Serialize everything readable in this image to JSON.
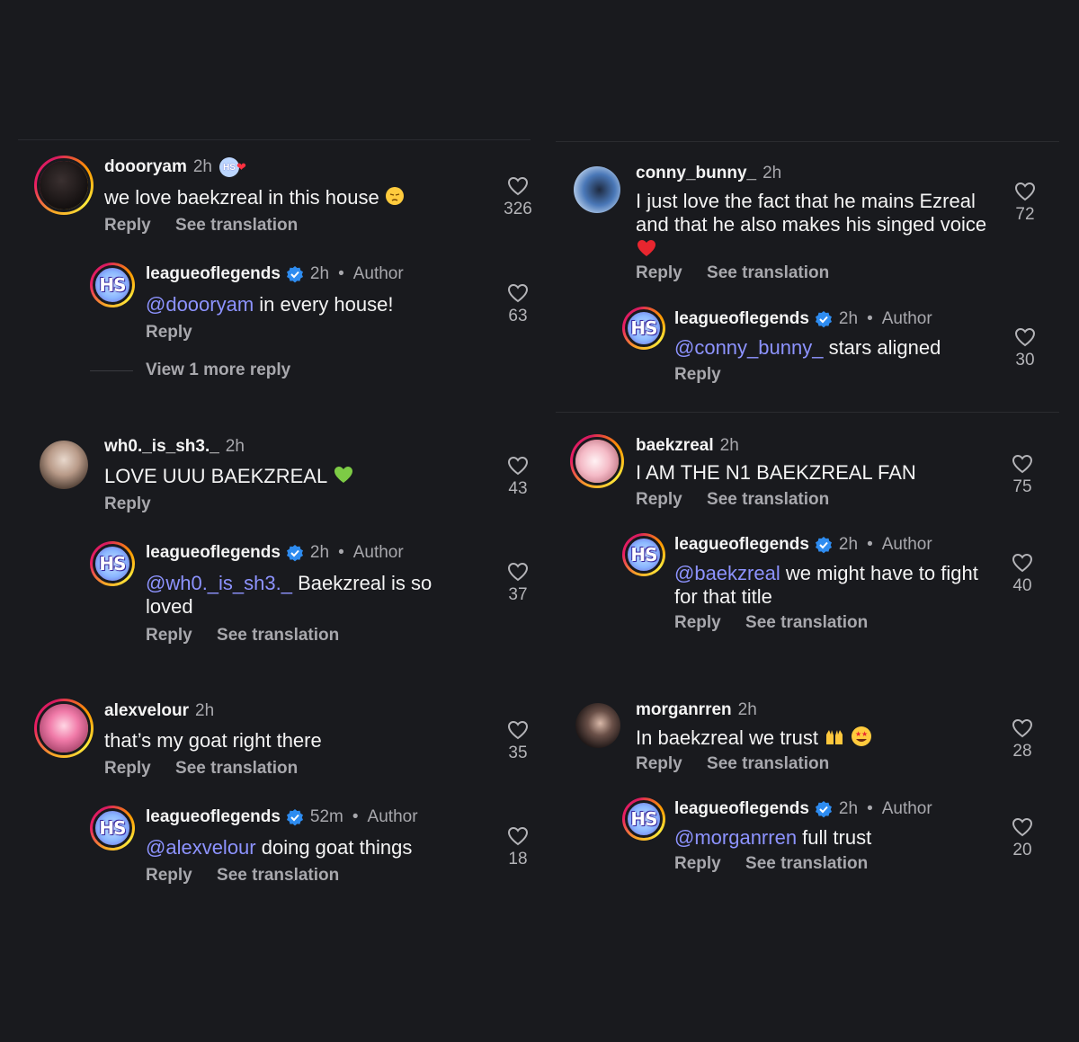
{
  "ui": {
    "reply": "Reply",
    "see_translation": "See translation",
    "author": "Author",
    "dot": "•"
  },
  "left": [
    {
      "user": "doooryam",
      "time": "2h",
      "text": "we love baekzreal in this house",
      "likes": "326",
      "reply": {
        "user": "leagueoflegends",
        "time": "2h",
        "mention": "@doooryam",
        "text": " in every house!",
        "likes": "63",
        "view_more": "View 1 more reply"
      }
    },
    {
      "user": "wh0._is_sh3._",
      "time": "2h",
      "text": "LOVE UUU BAEKZREAL",
      "likes": "43",
      "reply": {
        "user": "leagueoflegends",
        "time": "2h",
        "mention": "@wh0._is_sh3._",
        "text": " Baekzreal is so loved",
        "likes": "37"
      }
    },
    {
      "user": "alexvelour",
      "time": "2h",
      "text": "that’s my goat right there",
      "likes": "35",
      "reply": {
        "user": "leagueoflegends",
        "time": "52m",
        "mention": "@alexvelour",
        "text": " doing goat things",
        "likes": "18"
      }
    }
  ],
  "right": [
    {
      "user": "conny_bunny_",
      "time": "2h",
      "text": "I just love the fact that he mains Ezreal and that he also makes his singed voice",
      "likes": "72",
      "reply": {
        "user": "leagueoflegends",
        "time": "2h",
        "mention": "@conny_bunny_",
        "text": " stars aligned",
        "likes": "30"
      }
    },
    {
      "user": "baekzreal",
      "time": "2h",
      "text": "I AM THE N1 BAEKZREAL FAN",
      "likes": "75",
      "reply": {
        "user": "leagueoflegends",
        "time": "2h",
        "mention": "@baekzreal",
        "text": " we might have to fight for that title",
        "likes": "40"
      }
    },
    {
      "user": "morganrren",
      "time": "2h",
      "text": "In baekzreal we trust",
      "likes": "28",
      "reply": {
        "user": "leagueoflegends",
        "time": "2h",
        "mention": "@morganrren",
        "text": " full trust",
        "likes": "20"
      }
    }
  ],
  "badge": "HS",
  "icons": {
    "like": "heart-outline-icon",
    "verified": "verified-badge-icon"
  },
  "colors": {
    "background": "#191a1e",
    "mention": "#8d93ff",
    "muted": "#a8a8ad",
    "verified": "#2e8cf0"
  }
}
